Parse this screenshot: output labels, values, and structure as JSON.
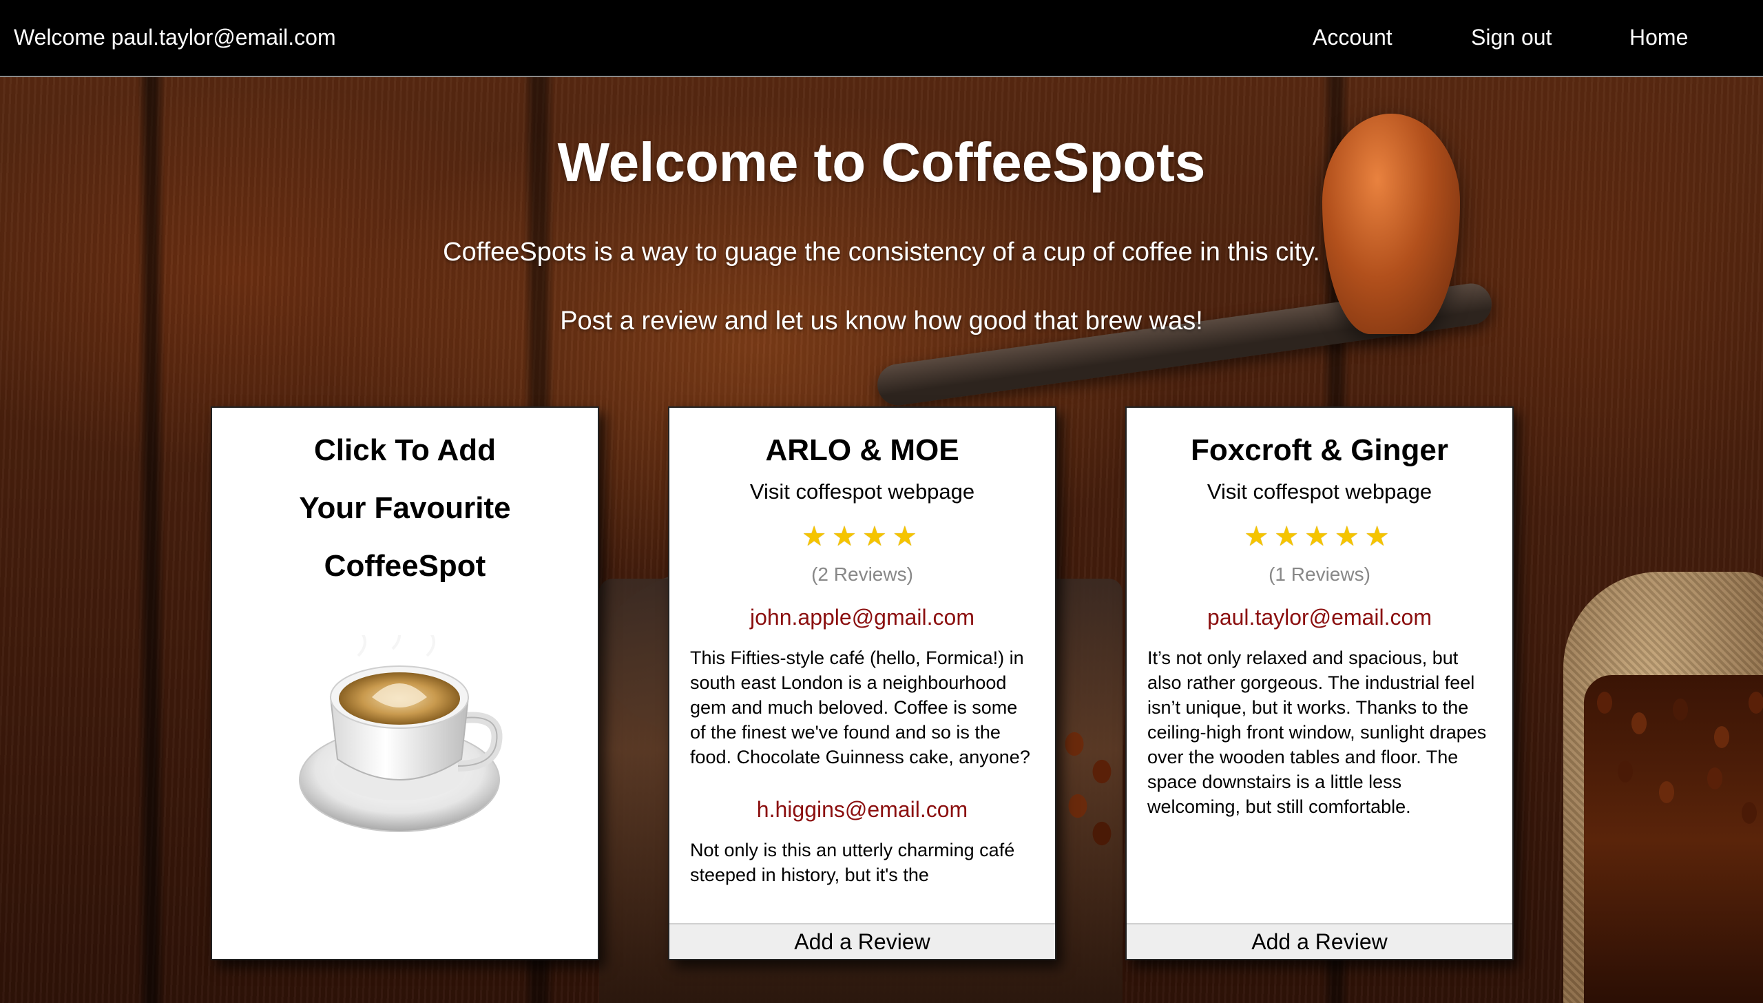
{
  "topbar": {
    "welcome": "Welcome paul.taylor@email.com",
    "nav": {
      "account": "Account",
      "signout": "Sign out",
      "home": "Home"
    }
  },
  "hero": {
    "title": "Welcome to CoffeeSpots",
    "line1": "CoffeeSpots is a way to guage the consistency of a cup of coffee in this city.",
    "line2": "Post a review and let us know how good that brew was!"
  },
  "add_card": {
    "line1": "Click To Add",
    "line2": "Your Favourite",
    "line3": "CoffeeSpot"
  },
  "spots": [
    {
      "name": "ARLO & MOE",
      "link": "Visit coffespot webpage",
      "rating": 4,
      "stars": "★★★★",
      "reviews_count": "(2 Reviews)",
      "reviews": [
        {
          "author": "john.apple@gmail.com",
          "text": "This Fifties-style café (hello, Formica!) in south east London is a neighbourhood gem and much beloved. Coffee is some of the finest we've found and so is the food. Chocolate Guinness cake, anyone?"
        },
        {
          "author": "h.higgins@email.com",
          "text": "Not only is this an utterly charming café steeped in history, but it's the"
        }
      ],
      "add_review": "Add a Review"
    },
    {
      "name": "Foxcroft & Ginger",
      "link": "Visit coffespot webpage",
      "rating": 5,
      "stars": "★★★★★",
      "reviews_count": "(1 Reviews)",
      "reviews": [
        {
          "author": "paul.taylor@email.com",
          "text": "It’s not only relaxed and spacious, but also rather gorgeous. The industrial feel isn’t unique, but it works. Thanks to the ceiling-high front window, sunlight drapes over the wooden tables and floor. The space downstairs is a little less welcoming, but still comfortable."
        }
      ],
      "add_review": "Add a Review"
    }
  ],
  "colors": {
    "topbar_bg": "#000000",
    "reviewer_link": "#8b0f0f",
    "star": "#f5c400",
    "add_review_bg": "#eeeeee"
  },
  "icons": {
    "cup": "coffee-cup-icon",
    "star": "star-icon"
  }
}
